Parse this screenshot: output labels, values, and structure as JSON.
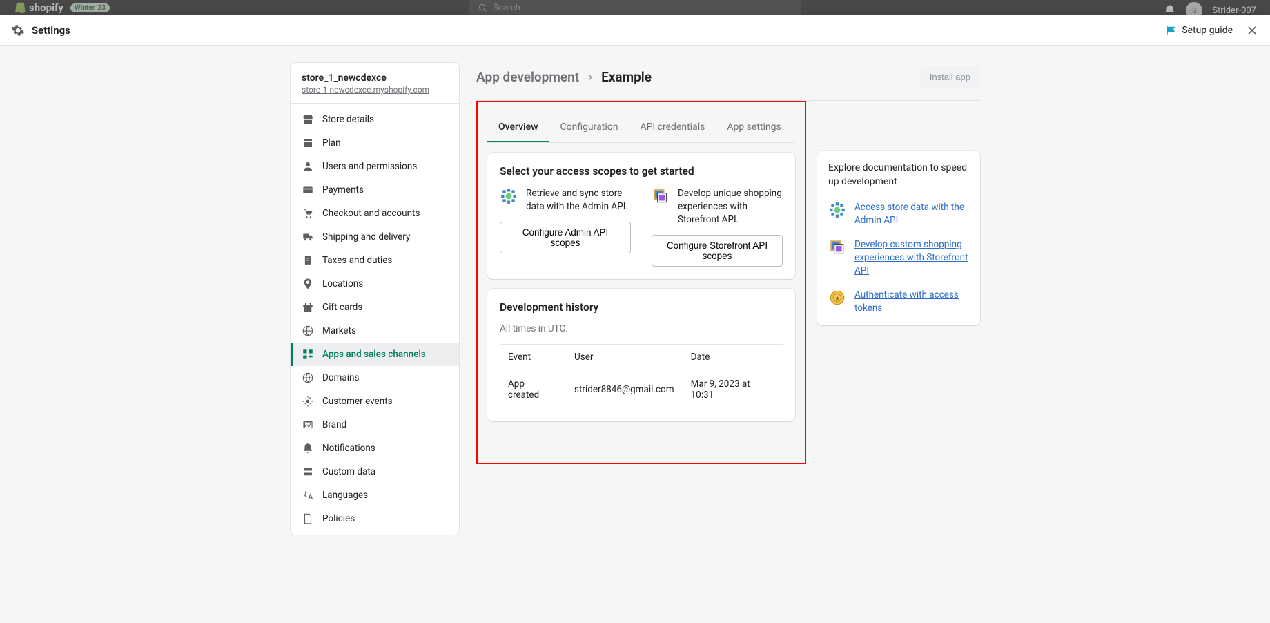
{
  "bg": {
    "logo": "shopify",
    "badge": "Winter '23",
    "search_placeholder": "Search",
    "username": "Strider-007",
    "avatar_initial": "S"
  },
  "modal": {
    "title": "Settings",
    "setup_guide": "Setup guide"
  },
  "sidebar": {
    "store_name": "store_1_newcdexce",
    "store_domain": "store-1-newcdexce.myshopify.com",
    "items": [
      {
        "label": "Store details"
      },
      {
        "label": "Plan"
      },
      {
        "label": "Users and permissions"
      },
      {
        "label": "Payments"
      },
      {
        "label": "Checkout and accounts"
      },
      {
        "label": "Shipping and delivery"
      },
      {
        "label": "Taxes and duties"
      },
      {
        "label": "Locations"
      },
      {
        "label": "Gift cards"
      },
      {
        "label": "Markets"
      },
      {
        "label": "Apps and sales channels"
      },
      {
        "label": "Domains"
      },
      {
        "label": "Customer events"
      },
      {
        "label": "Brand"
      },
      {
        "label": "Notifications"
      },
      {
        "label": "Custom data"
      },
      {
        "label": "Languages"
      },
      {
        "label": "Policies"
      }
    ]
  },
  "main": {
    "breadcrumb_parent": "App development",
    "breadcrumb_current": "Example",
    "install_label": "Install app",
    "tabs": [
      "Overview",
      "Configuration",
      "API credentials",
      "App settings"
    ],
    "scope_card": {
      "title": "Select your access scopes to get started",
      "admin_desc": "Retrieve and sync store data with the Admin API.",
      "admin_btn": "Configure Admin API scopes",
      "storefront_desc": "Develop unique shopping experiences with Storefront API.",
      "storefront_btn": "Configure Storefront API scopes"
    },
    "history": {
      "title": "Development history",
      "subtitle": "All times in UTC.",
      "columns": [
        "Event",
        "User",
        "Date"
      ],
      "rows": [
        {
          "event": "App created",
          "user": "strider8846@gmail.com",
          "date": "Mar 9, 2023 at 10:31"
        }
      ]
    }
  },
  "docs": {
    "heading": "Explore documentation to speed up development",
    "links": [
      "Access store data with the Admin API",
      "Develop custom shopping experiences with Storefront API",
      "Authenticate with access tokens"
    ]
  }
}
